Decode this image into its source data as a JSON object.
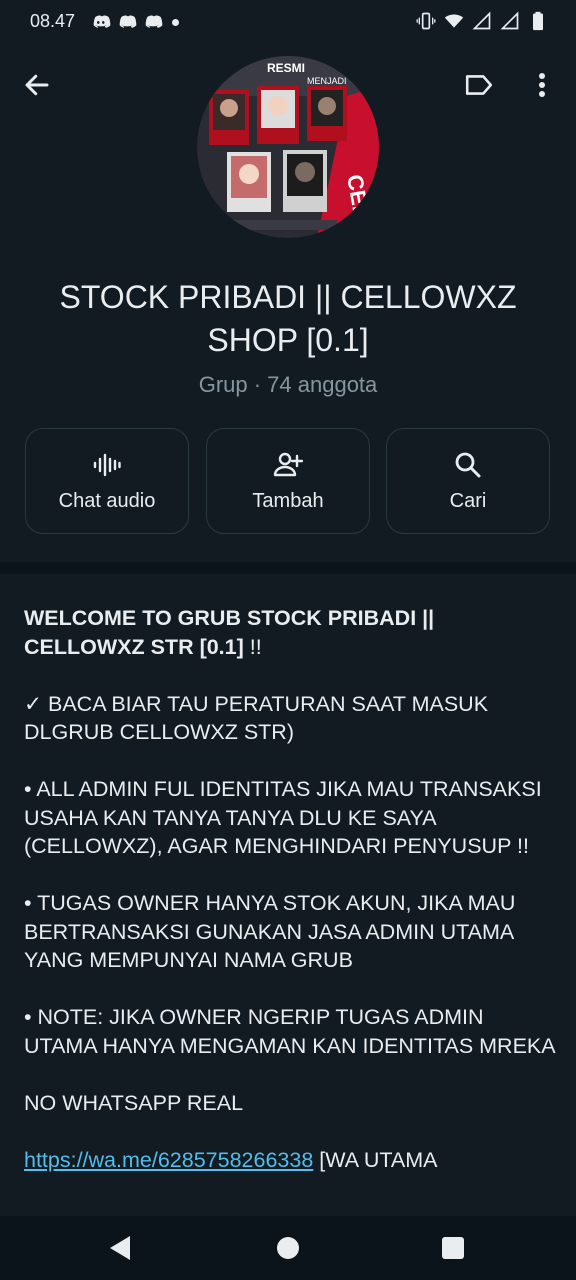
{
  "status_bar": {
    "time": "08.47",
    "notification_icons": [
      "discord-icon",
      "discord-icon",
      "discord-icon",
      "more-notifications-dot"
    ],
    "system_icons": [
      "vibrate-icon",
      "wifi-icon",
      "signal-icon",
      "signal-icon",
      "battery-icon"
    ]
  },
  "header": {
    "avatar_text": {
      "top": "RESMI",
      "sub": "MENJADI",
      "bottom": "CELLOWXZ STR"
    },
    "title": "STOCK PRIBADI || CELLOWXZ SHOP [0.1]",
    "subtitle": "Grup · 74 anggota",
    "actions": [
      {
        "label": "Chat audio",
        "icon": "audio-wave-icon"
      },
      {
        "label": "Tambah",
        "icon": "add-person-icon"
      },
      {
        "label": "Cari",
        "icon": "search-icon"
      }
    ]
  },
  "description": {
    "heading_bold": "WELCOME TO GRUB STOCK PRIBADI || CELLOWXZ STR [0.1]",
    "heading_suffix": " !!",
    "paragraphs": [
      "✓ BACA BIAR TAU PERATURAN SAAT MASUK DLGRUB CELLOWXZ STR)",
      "• ALL ADMIN FUL IDENTITAS JIKA MAU TRANSAKSI USAHA KAN TANYA TANYA DLU KE SAYA (CELLOWXZ), AGAR MENGHINDARI PENYUSUP !!",
      "• TUGAS OWNER HANYA STOK AKUN, JIKA MAU BERTRANSAKSI GUNAKAN JASA ADMIN UTAMA YANG MEMPUNYAI NAMA GRUB",
      "• NOTE: JIKA OWNER NGERIP TUGAS ADMIN UTAMA HANYA MENGAMAN KAN IDENTITAS MREKA",
      "NO WHATSAPP REAL"
    ],
    "link": "https://wa.me/6285758266338",
    "link_suffix": " [WA UTAMA"
  },
  "colors": {
    "background": "#121b22",
    "text": "#e9edef",
    "muted": "#8696a0",
    "link": "#53bdeb",
    "card_border": "#2a3942"
  }
}
